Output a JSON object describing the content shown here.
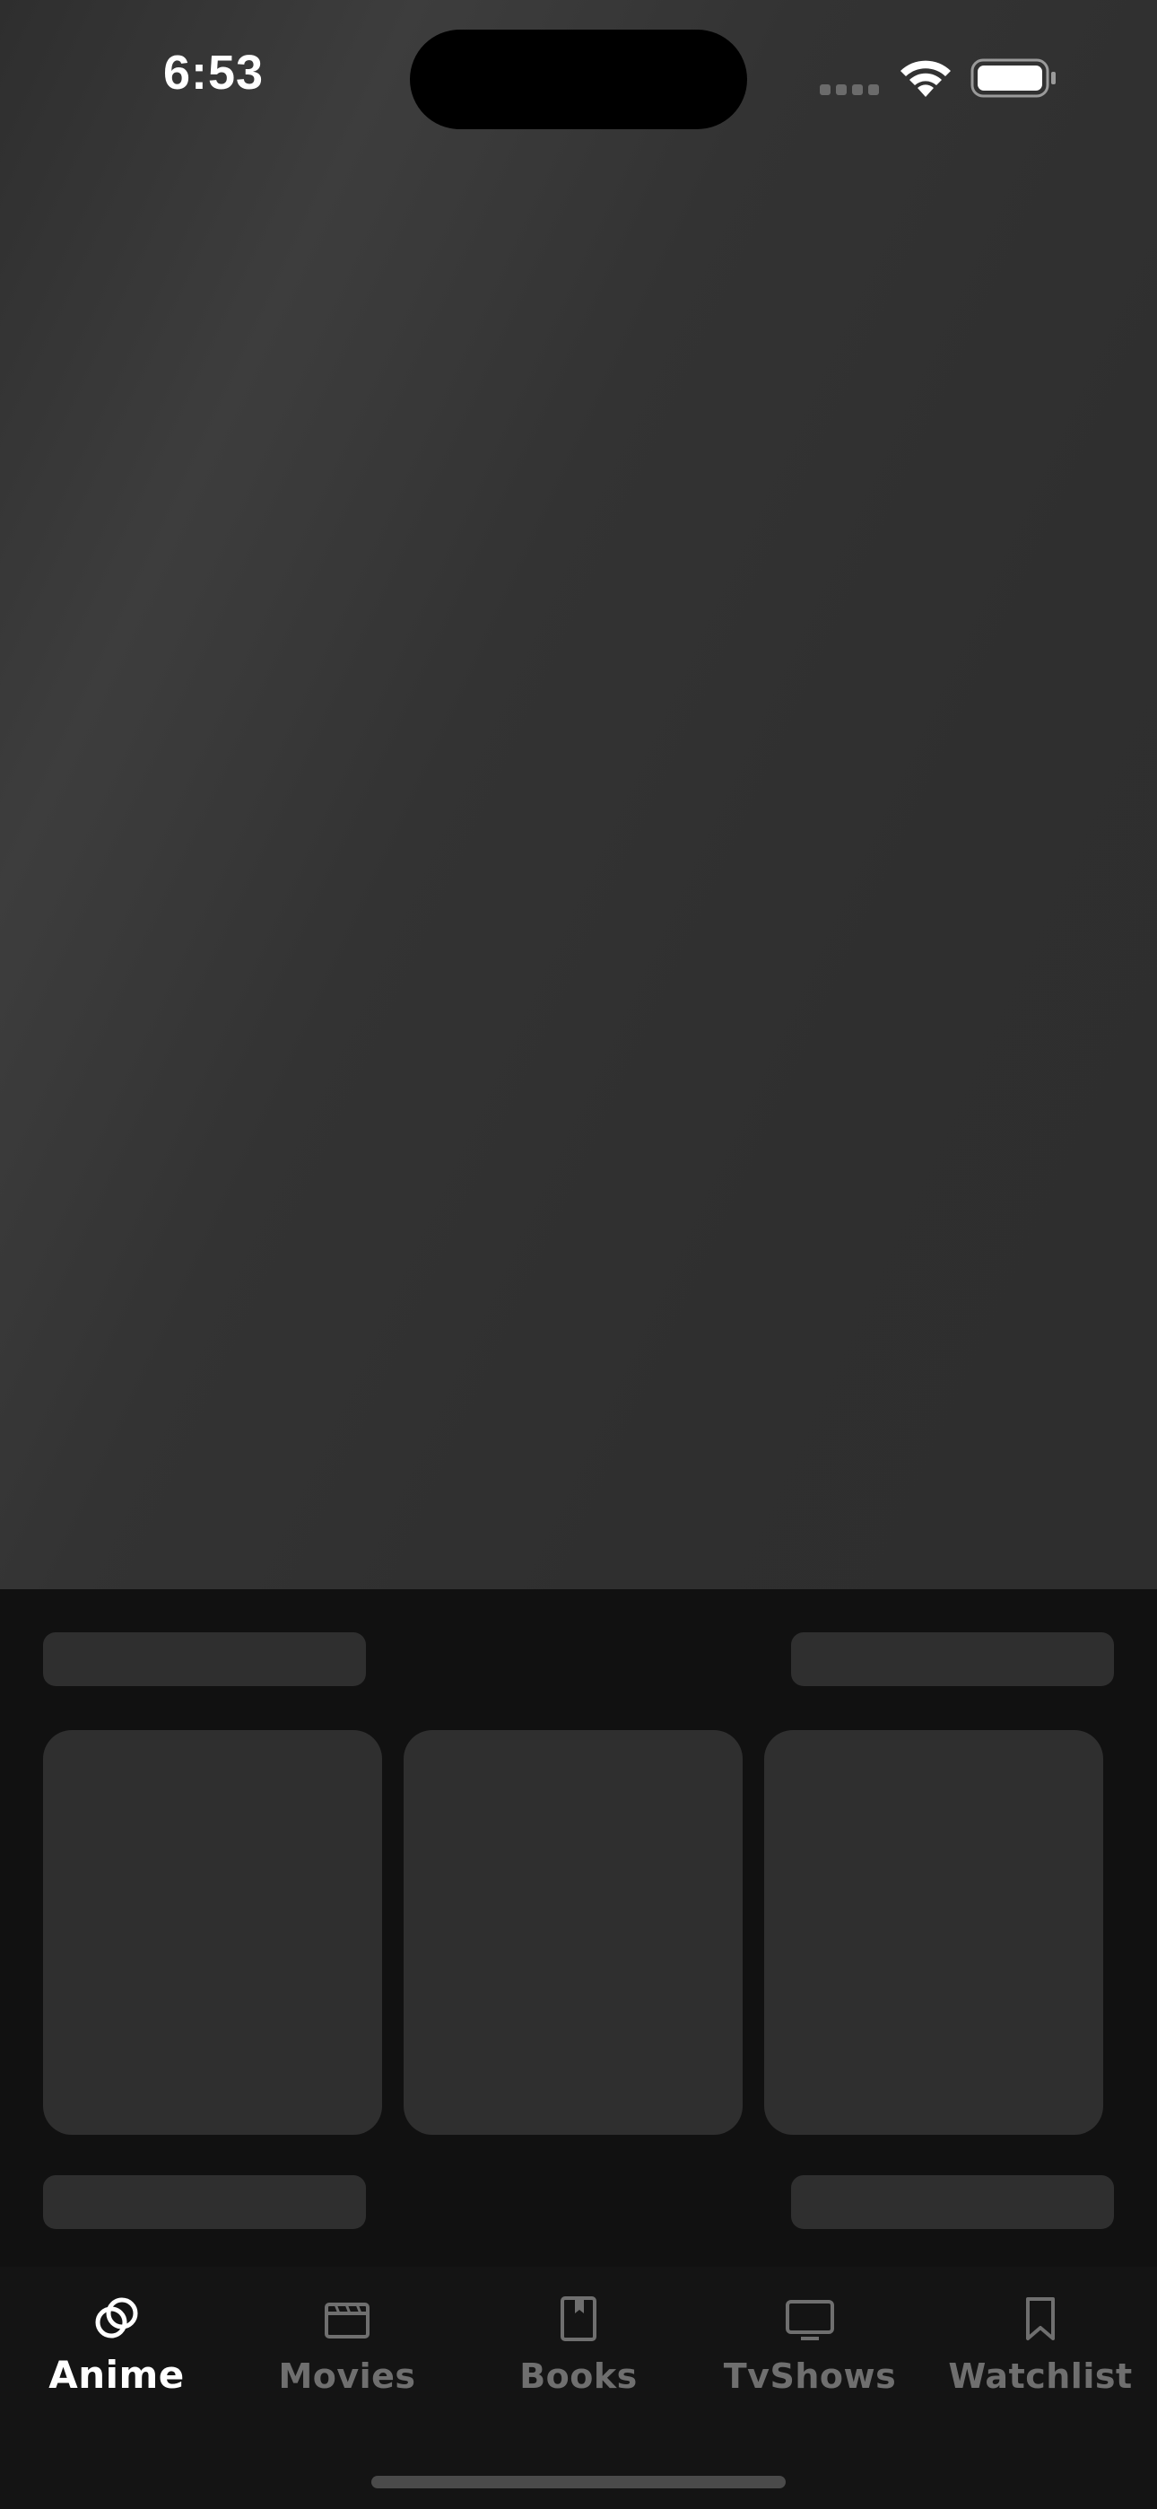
{
  "status_bar": {
    "time": "6:53"
  },
  "tabs": [
    {
      "label": "Anime",
      "icon": "rings-icon",
      "active": true
    },
    {
      "label": "Movies",
      "icon": "clapperboard-icon",
      "active": false
    },
    {
      "label": "Books",
      "icon": "book-icon",
      "active": false
    },
    {
      "label": "TvShows",
      "icon": "tv-icon",
      "active": false
    },
    {
      "label": "Watchlist",
      "icon": "bookmark-icon",
      "active": false
    }
  ],
  "colors": {
    "background": "#111111",
    "skeleton": "#2f2f2f",
    "tab_active": "#ffffff",
    "tab_inactive": "#6f6f6f"
  }
}
